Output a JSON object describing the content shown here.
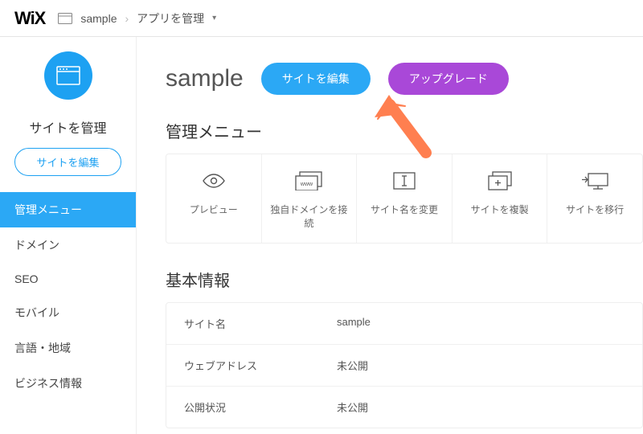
{
  "brand": "WiX",
  "breadcrumb": {
    "site": "sample",
    "section": "アプリを管理"
  },
  "sidebar": {
    "title": "サイトを管理",
    "edit_label": "サイトを編集",
    "items": [
      {
        "label": "管理メニュー",
        "active": true
      },
      {
        "label": "ドメイン"
      },
      {
        "label": "SEO"
      },
      {
        "label": "モバイル"
      },
      {
        "label": "言語・地域"
      },
      {
        "label": "ビジネス情報"
      }
    ]
  },
  "main": {
    "title": "sample",
    "edit_btn": "サイトを編集",
    "upgrade_btn": "アップグレード",
    "menu_title": "管理メニュー",
    "cards": [
      {
        "label": "プレビュー"
      },
      {
        "label": "独自ドメインを接続"
      },
      {
        "label": "サイト名を変更"
      },
      {
        "label": "サイトを複製"
      },
      {
        "label": "サイトを移行"
      }
    ],
    "info_title": "基本情報",
    "info_rows": [
      {
        "key": "サイト名",
        "value": "sample"
      },
      {
        "key": "ウェブアドレス",
        "value": "未公開"
      },
      {
        "key": "公開状況",
        "value": "未公開"
      }
    ]
  },
  "colors": {
    "blue": "#2BA8F5",
    "purple": "#A948D8"
  }
}
